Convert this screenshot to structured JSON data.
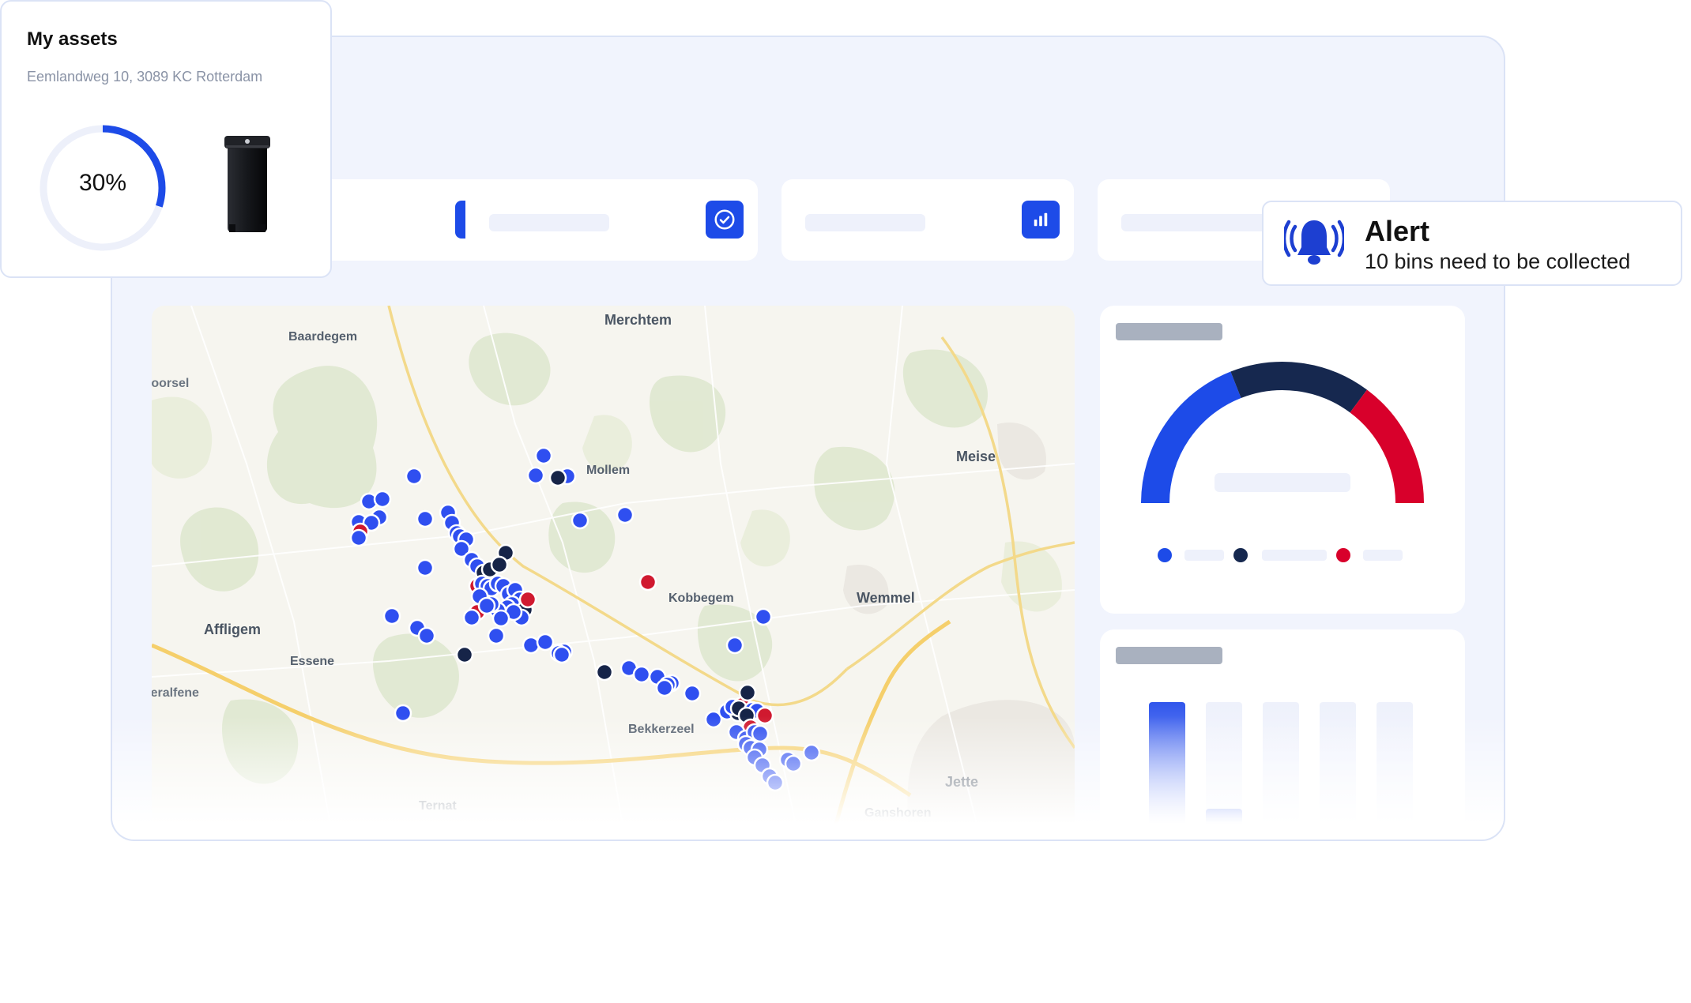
{
  "assets": {
    "title": "My assets",
    "address": "Eemlandweg 10, 3089 KC Rotterdam",
    "fill_percent_label": "30%",
    "fill_fraction": 0.3,
    "accent_color": "#1d4be8"
  },
  "alert": {
    "title": "Alert",
    "message": "10 bins need to be collected",
    "icon": "bell-ringing-icon"
  },
  "stat_cards": [
    {
      "icon": "trash-icon"
    },
    {
      "icon": "check-circle-icon"
    },
    {
      "icon": "bar-chart-icon"
    },
    {
      "icon": "generic-icon"
    }
  ],
  "map": {
    "places": {
      "merchtem": "Merchtem",
      "baardegem": "Baardegem",
      "moorsel": "Moorsel",
      "mollem": "Mollem",
      "meise": "Meise",
      "kobbegem": "Kobbegem",
      "wemmel": "Wemmel",
      "affligem": "Affligem",
      "essene": "Essene",
      "teralfene": "Teralfene",
      "bekkerzeel": "Bekkerzeel",
      "jette": "Jette",
      "ternat": "Ternat",
      "ganshoren": "Ganshoren"
    },
    "marker_colors": {
      "normal": "#2f4ff0",
      "full": "#162448",
      "alert": "#d0192f"
    }
  },
  "gauge": {
    "segments": [
      {
        "status": "normal",
        "color": "#1d4be8"
      },
      {
        "status": "full",
        "color": "#16284f"
      },
      {
        "status": "alert",
        "color": "#d8002b"
      }
    ]
  },
  "bar_chart": {
    "fill_fractions": [
      1.0,
      0.25,
      0.13,
      0.02,
      0.0
    ]
  }
}
